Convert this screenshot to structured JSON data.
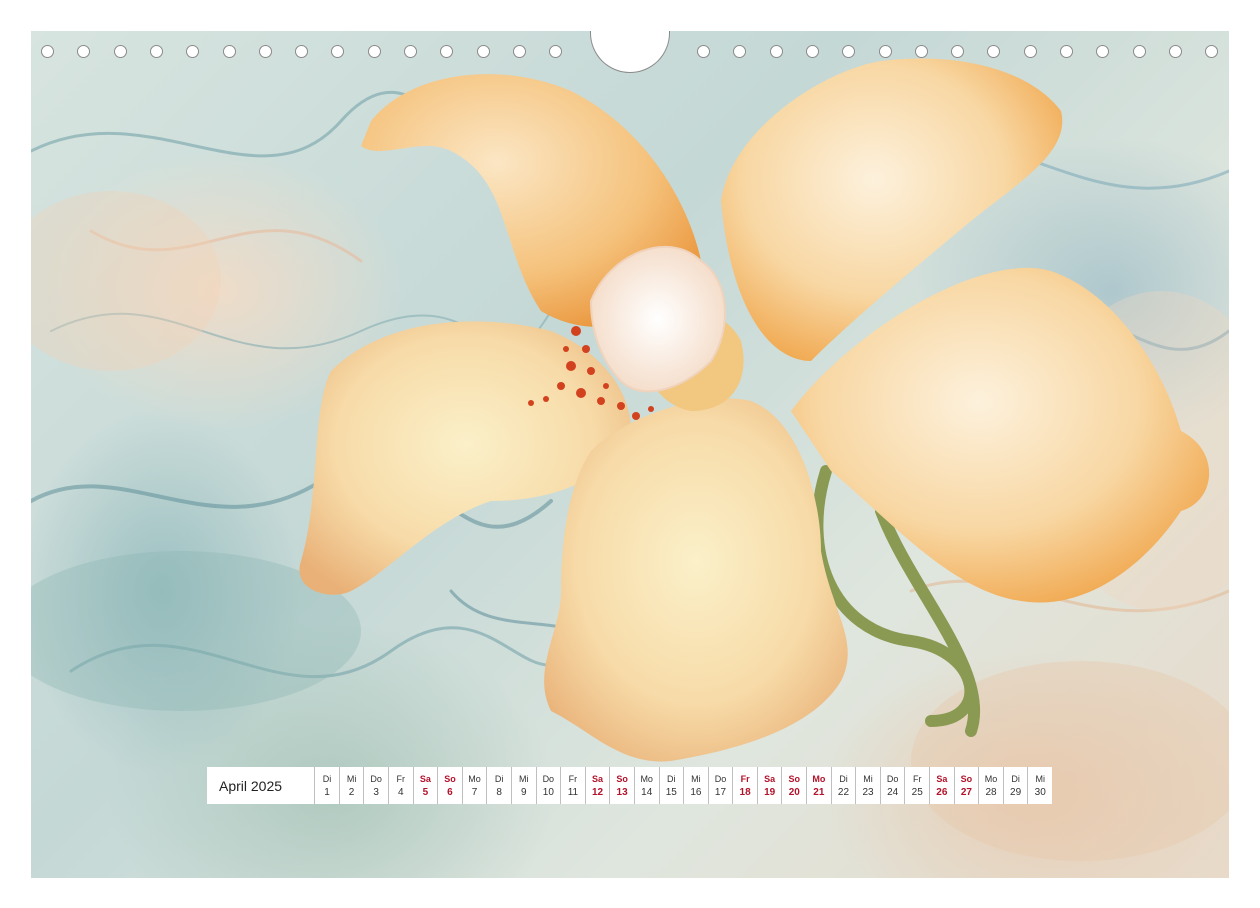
{
  "calendar": {
    "month": "April 2025",
    "accent_color": "#b3122a",
    "days": [
      {
        "n": "Di",
        "d": "1",
        "we": false
      },
      {
        "n": "Mi",
        "d": "2",
        "we": false
      },
      {
        "n": "Do",
        "d": "3",
        "we": false
      },
      {
        "n": "Fr",
        "d": "4",
        "we": false
      },
      {
        "n": "Sa",
        "d": "5",
        "we": true
      },
      {
        "n": "So",
        "d": "6",
        "we": true
      },
      {
        "n": "Mo",
        "d": "7",
        "we": false
      },
      {
        "n": "Di",
        "d": "8",
        "we": false
      },
      {
        "n": "Mi",
        "d": "9",
        "we": false
      },
      {
        "n": "Do",
        "d": "10",
        "we": false
      },
      {
        "n": "Fr",
        "d": "11",
        "we": false
      },
      {
        "n": "Sa",
        "d": "12",
        "we": true
      },
      {
        "n": "So",
        "d": "13",
        "we": true
      },
      {
        "n": "Mo",
        "d": "14",
        "we": false
      },
      {
        "n": "Di",
        "d": "15",
        "we": false
      },
      {
        "n": "Mi",
        "d": "16",
        "we": false
      },
      {
        "n": "Do",
        "d": "17",
        "we": false
      },
      {
        "n": "Fr",
        "d": "18",
        "we": true
      },
      {
        "n": "Sa",
        "d": "19",
        "we": true
      },
      {
        "n": "So",
        "d": "20",
        "we": true
      },
      {
        "n": "Mo",
        "d": "21",
        "we": true
      },
      {
        "n": "Di",
        "d": "22",
        "we": false
      },
      {
        "n": "Mi",
        "d": "23",
        "we": false
      },
      {
        "n": "Do",
        "d": "24",
        "we": false
      },
      {
        "n": "Fr",
        "d": "25",
        "we": false
      },
      {
        "n": "Sa",
        "d": "26",
        "we": true
      },
      {
        "n": "So",
        "d": "27",
        "we": true
      },
      {
        "n": "Mo",
        "d": "28",
        "we": false
      },
      {
        "n": "Di",
        "d": "29",
        "we": false
      },
      {
        "n": "Mi",
        "d": "30",
        "we": false
      }
    ]
  },
  "artwork": {
    "subject": "orchid-illustration",
    "colors": {
      "petal": "#f6c98a",
      "petal_light": "#fbe6c4",
      "petal_deep": "#ef9f3f",
      "lip": "#fdf3ea",
      "speckle": "#d2421e",
      "stem": "#8a9a52",
      "smoke_teal": "#6f9fa6"
    }
  }
}
